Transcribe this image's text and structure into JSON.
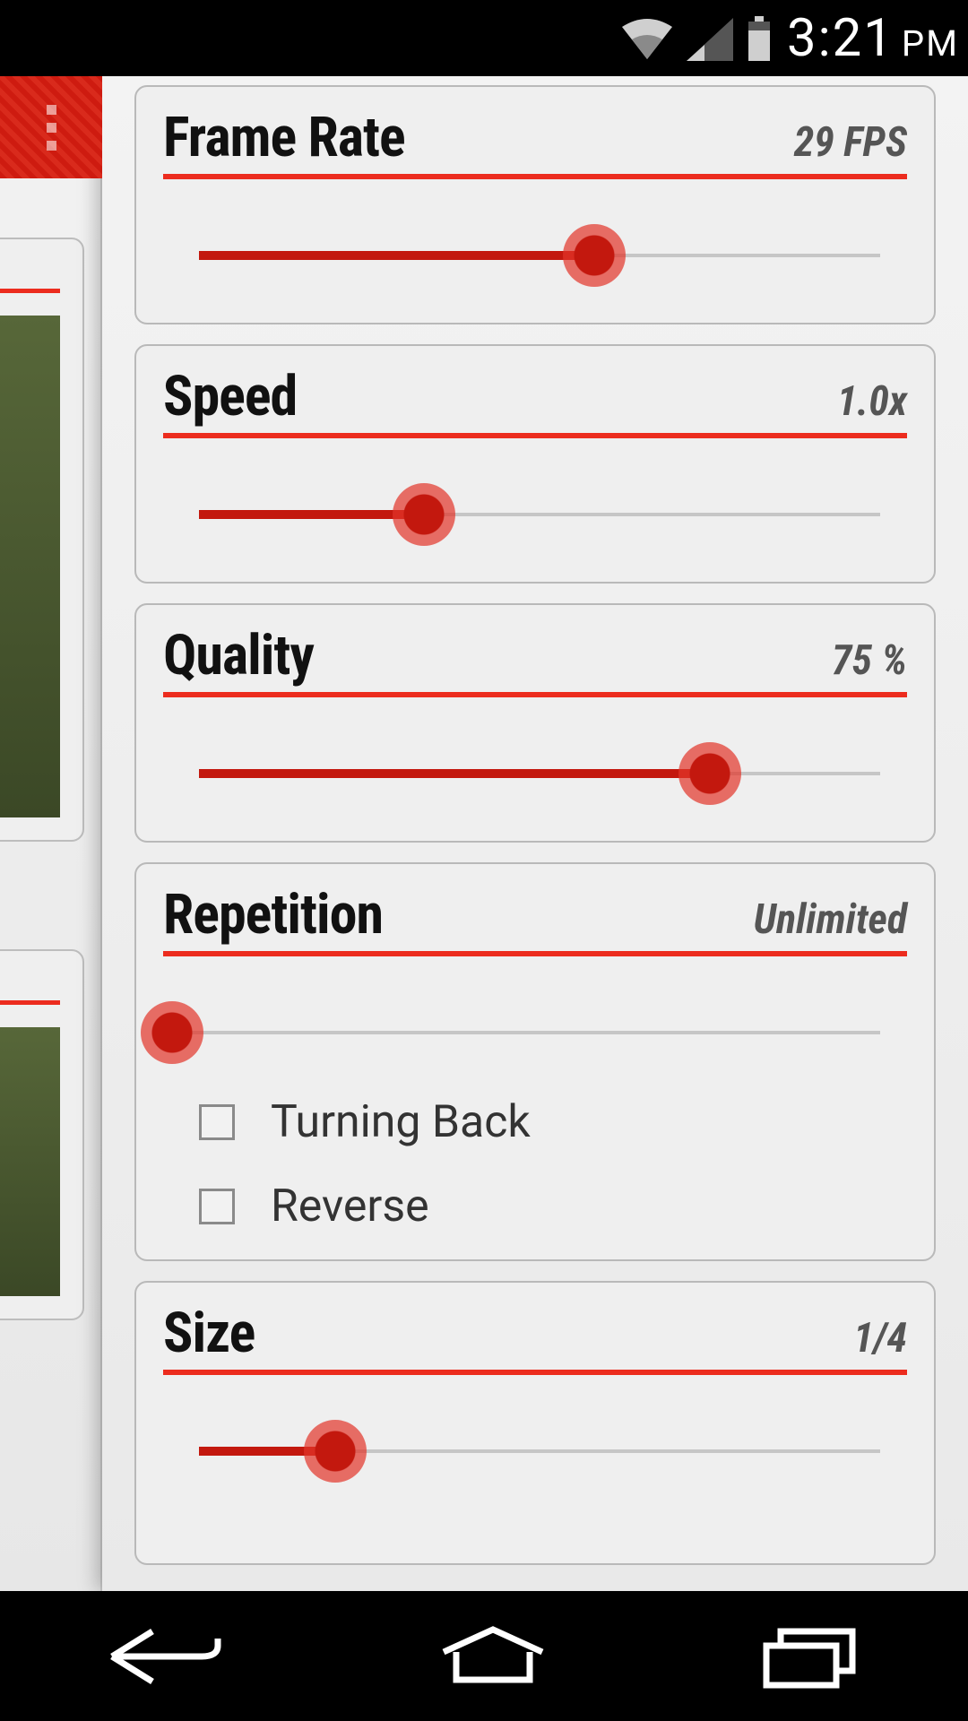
{
  "statusbar": {
    "time": "3:21",
    "ampm": "PM"
  },
  "settings": {
    "frame_rate": {
      "label": "Frame Rate",
      "value": "29 FPS",
      "percent": 58
    },
    "speed": {
      "label": "Speed",
      "value": "1.0x",
      "percent": 33
    },
    "quality": {
      "label": "Quality",
      "value": "75 %",
      "percent": 75
    },
    "repetition": {
      "label": "Repetition",
      "value": "Unlimited",
      "percent": 0,
      "turning_back_label": "Turning Back",
      "turning_back_checked": false,
      "reverse_label": "Reverse",
      "reverse_checked": false
    },
    "size": {
      "label": "Size",
      "value": "1/4",
      "percent": 20
    }
  }
}
